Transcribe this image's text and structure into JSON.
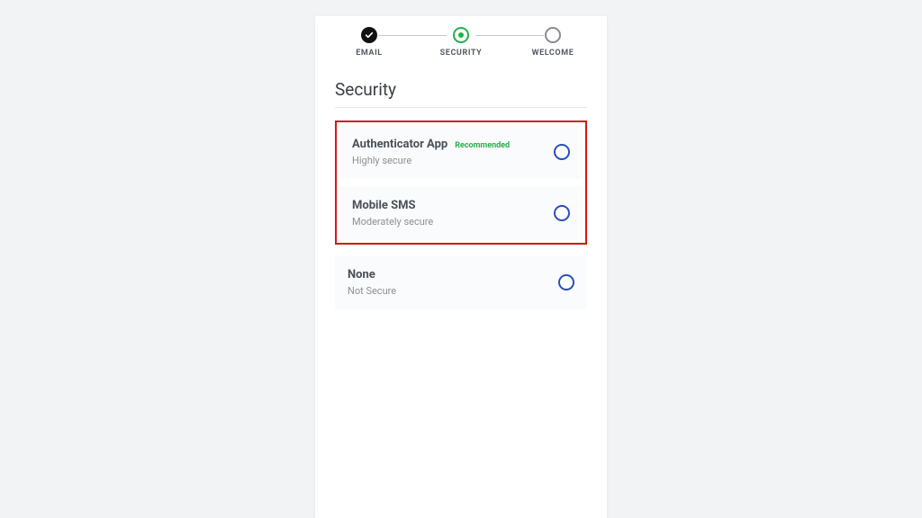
{
  "stepper": {
    "steps": [
      {
        "label": "EMAIL",
        "state": "done"
      },
      {
        "label": "SECURITY",
        "state": "active"
      },
      {
        "label": "WELCOME",
        "state": "upcoming"
      }
    ]
  },
  "section_title": "Security",
  "options": [
    {
      "title": "Authenticator App",
      "badge": "Recommended",
      "subtitle": "Highly secure"
    },
    {
      "title": "Mobile SMS",
      "badge": "",
      "subtitle": "Moderately secure"
    },
    {
      "title": "None",
      "badge": "",
      "subtitle": "Not Secure"
    }
  ]
}
